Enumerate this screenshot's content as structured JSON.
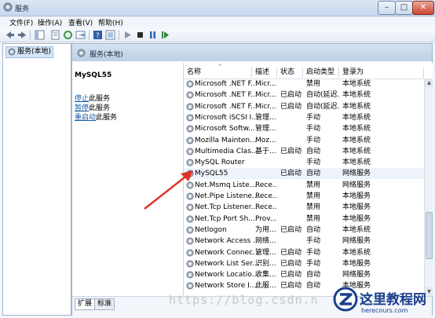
{
  "window": {
    "title": "服务"
  },
  "menu": [
    "文件(F)",
    "操作(A)",
    "查看(V)",
    "帮助(H)"
  ],
  "tree": {
    "label": "服务(本地)"
  },
  "main_header": "服务(本地)",
  "description": {
    "title": "MySQL55",
    "links": [
      {
        "link": "停止",
        "rest": "此服务"
      },
      {
        "link": "暂停",
        "rest": "此服务"
      },
      {
        "link": "重启动",
        "rest": "此服务"
      }
    ]
  },
  "columns": [
    "名称",
    "描述",
    "状态",
    "启动类型",
    "登录为"
  ],
  "services": [
    {
      "name": "Microsoft .NET F...",
      "desc": "Micr...",
      "status": "",
      "startup": "禁用",
      "logon": "本地系统"
    },
    {
      "name": "Microsoft .NET F...",
      "desc": "Micr...",
      "status": "已启动",
      "startup": "自动(延迟...",
      "logon": "本地系统"
    },
    {
      "name": "Microsoft .NET F...",
      "desc": "Micr...",
      "status": "已启动",
      "startup": "自动(延迟...",
      "logon": "本地系统"
    },
    {
      "name": "Microsoft iSCSI I...",
      "desc": "管理...",
      "status": "",
      "startup": "手动",
      "logon": "本地系统"
    },
    {
      "name": "Microsoft Softw...",
      "desc": "管理...",
      "status": "",
      "startup": "手动",
      "logon": "本地系统"
    },
    {
      "name": "Mozilla Mainten...",
      "desc": "Moz...",
      "status": "",
      "startup": "手动",
      "logon": "本地系统"
    },
    {
      "name": "Multimedia Clas...",
      "desc": "基于...",
      "status": "已启动",
      "startup": "自动",
      "logon": "本地系统"
    },
    {
      "name": "MySQL Router",
      "desc": "",
      "status": "",
      "startup": "手动",
      "logon": "本地系统"
    },
    {
      "name": "MySQL55",
      "desc": "",
      "status": "已启动",
      "startup": "自动",
      "logon": "网络服务"
    },
    {
      "name": "Net.Msmq Liste...",
      "desc": "Rece...",
      "status": "",
      "startup": "禁用",
      "logon": "网络服务"
    },
    {
      "name": "Net.Pipe Listene...",
      "desc": "Rece...",
      "status": "",
      "startup": "禁用",
      "logon": "本地服务"
    },
    {
      "name": "Net.Tcp Listener...",
      "desc": "Rece...",
      "status": "",
      "startup": "禁用",
      "logon": "本地服务"
    },
    {
      "name": "Net.Tcp Port Sh...",
      "desc": "Prov...",
      "status": "",
      "startup": "禁用",
      "logon": "本地服务"
    },
    {
      "name": "Netlogon",
      "desc": "为用...",
      "status": "已启动",
      "startup": "自动",
      "logon": "本地系统"
    },
    {
      "name": "Network Access ...",
      "desc": "网络...",
      "status": "",
      "startup": "手动",
      "logon": "网络服务"
    },
    {
      "name": "Network Connec...",
      "desc": "管理...",
      "status": "已启动",
      "startup": "手动",
      "logon": "本地系统"
    },
    {
      "name": "Network List Ser...",
      "desc": "识别...",
      "status": "已启动",
      "startup": "手动",
      "logon": "本地服务"
    },
    {
      "name": "Network Locatio...",
      "desc": "收集...",
      "status": "已启动",
      "startup": "自动",
      "logon": "网络服务"
    },
    {
      "name": "Network Store I...",
      "desc": "此服...",
      "status": "已启动",
      "startup": "自动",
      "logon": "本地服务"
    }
  ],
  "tabs": [
    "扩展",
    "标准"
  ],
  "watermark": "https://blog.csdn.n",
  "logo": {
    "title": "这里教程网",
    "domain": "herecours.com"
  },
  "colors": {
    "accent": "#1a5aa8",
    "arrow": "#e0342a"
  }
}
